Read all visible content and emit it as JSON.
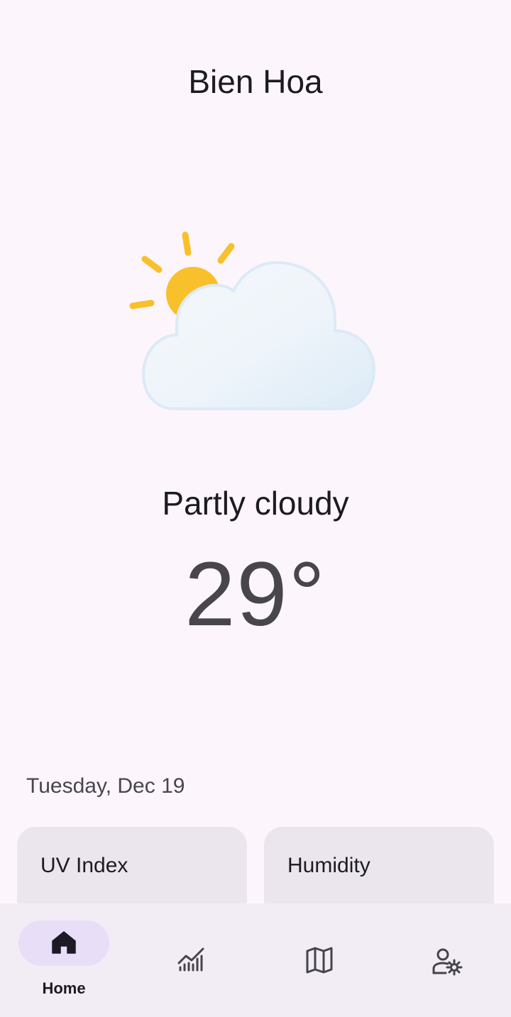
{
  "location": {
    "city": "Bien Hoa"
  },
  "current": {
    "condition": "Partly cloudy",
    "temperature": "29°",
    "icon": "partly-cloudy-sun-cloud-icon"
  },
  "date": "Tuesday, Dec 19",
  "cards": [
    {
      "title": "UV Index"
    },
    {
      "title": "Humidity"
    }
  ],
  "nav": {
    "items": [
      {
        "label": "Home",
        "icon": "home-icon",
        "selected": true
      },
      {
        "label": "",
        "icon": "chart-icon",
        "selected": false
      },
      {
        "label": "",
        "icon": "map-icon",
        "selected": false
      },
      {
        "label": "",
        "icon": "user-settings-icon",
        "selected": false
      }
    ]
  },
  "colors": {
    "background": "#fcf6fc",
    "nav_background": "#f2ecf4",
    "nav_active_pill": "#e8def8",
    "card_background": "#ebe6ee",
    "sun": "#f8c02a",
    "cloud": "#eef5fb"
  }
}
